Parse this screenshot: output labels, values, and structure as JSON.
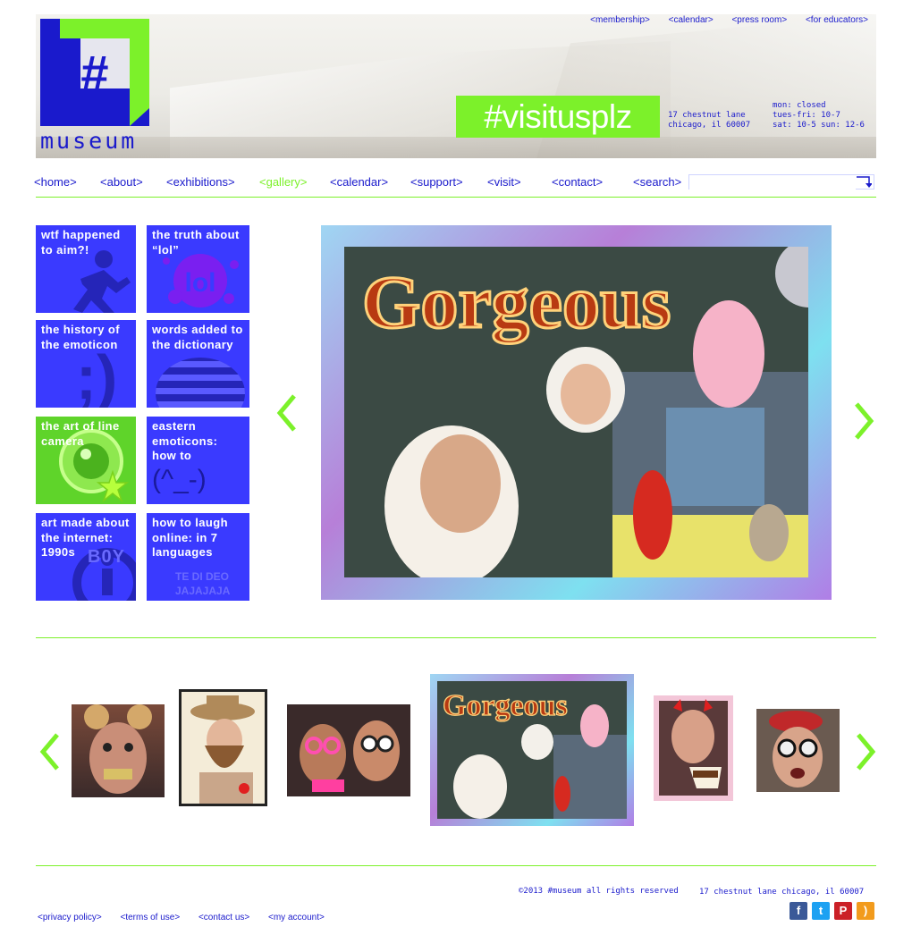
{
  "header": {
    "logo_word": "museum",
    "logo_glyph": "#",
    "top_links": [
      "<membership>",
      "<calendar>",
      "<press room>",
      "<for educators>"
    ],
    "tagline": "#visitusplz",
    "address_line1": "17 chestnut lane",
    "address_line2": "chicago, il 60007",
    "hours_line1": "mon: closed",
    "hours_line2": "tues-fri: 10-7",
    "hours_line3": "sat: 10-5  sun: 12-6"
  },
  "nav": {
    "items": [
      "<home>",
      "<about>",
      "<exhibitions>",
      "<gallery>",
      "<calendar>",
      "<support>",
      "<visit>",
      "<contact>",
      "<search>"
    ],
    "active": "<gallery>",
    "search_placeholder": ""
  },
  "tiles": [
    {
      "text": "wtf happened to aim?!"
    },
    {
      "text": "the truth about “lol”",
      "deco": "lol"
    },
    {
      "text": "the history of the emoticon",
      "deco": ";)"
    },
    {
      "text": "words added to the dictionary"
    },
    {
      "text": "the art of line camera"
    },
    {
      "text": "eastern emoticons: how to",
      "deco": "(^_-)"
    },
    {
      "text": "art made about the internet: 1990s",
      "deco": "B0Y"
    },
    {
      "text": "how to laugh online: in 7 languages",
      "deco1": "TE DI DEO",
      "deco2": "JAJAJAJA"
    }
  ],
  "gallery": {
    "main_caption": "Gorgeous",
    "thumb_caption": "Gorgeous"
  },
  "footer": {
    "copyright": "©2013 #museum all rights reserved",
    "address": "17 chestnut lane chicago, il 60007",
    "links": [
      "<privacy policy>",
      "<terms of use>",
      "<contact us>",
      "<my account>"
    ],
    "social": [
      {
        "icon": "facebook-icon",
        "glyph": "f",
        "color": "#3b5998"
      },
      {
        "icon": "twitter-icon",
        "glyph": "t",
        "color": "#1da1f2"
      },
      {
        "icon": "pinterest-icon",
        "glyph": "P",
        "color": "#cb2027"
      },
      {
        "icon": "rss-icon",
        "glyph": ")",
        "color": "#f29b1d"
      }
    ]
  },
  "colors": {
    "accent_green": "#7cf12a",
    "brand_blue": "#1a1acc",
    "tile_blue": "#3a3aff"
  }
}
